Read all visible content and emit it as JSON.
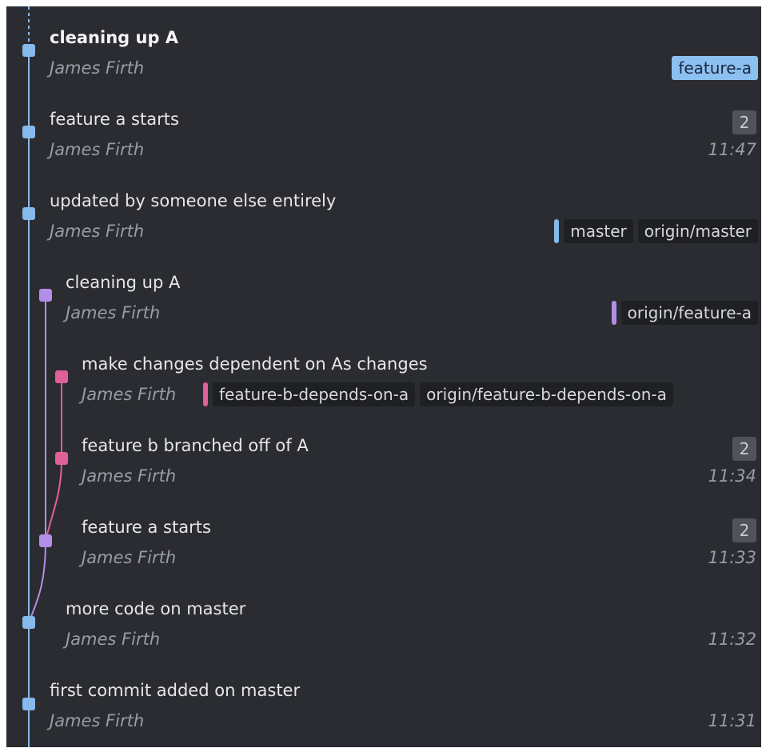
{
  "colors": {
    "background": "#2b2c31",
    "lane_master": "#86b9ec",
    "lane_feature_a": "#b38ee6",
    "lane_feature_b": "#e0609a",
    "active_tag": "#8cc0f0"
  },
  "commits": [
    {
      "subject": "cleaning up A",
      "author": "James Firth",
      "tags": [
        "feature-a"
      ]
    },
    {
      "subject": "feature a starts",
      "author": "James Firth",
      "count": "2",
      "time": "11:47"
    },
    {
      "subject": "updated by someone else entirely",
      "author": "James Firth",
      "tags": [
        "master",
        "origin/master"
      ]
    },
    {
      "subject": "cleaning up A",
      "author": "James Firth",
      "tags": [
        "origin/feature-a"
      ]
    },
    {
      "subject": "make changes dependent on As changes",
      "author": "James Firth",
      "tags": [
        "feature-b-depends-on-a",
        "origin/feature-b-depends-on-a"
      ]
    },
    {
      "subject": "feature b branched off of A",
      "author": "James Firth",
      "count": "2",
      "time": "11:34"
    },
    {
      "subject": "feature a starts",
      "author": "James Firth",
      "count": "2",
      "time": "11:33"
    },
    {
      "subject": "more code on master",
      "author": "James Firth",
      "time": "11:32"
    },
    {
      "subject": "first commit added on master",
      "author": "James Firth",
      "time": "11:31"
    }
  ]
}
